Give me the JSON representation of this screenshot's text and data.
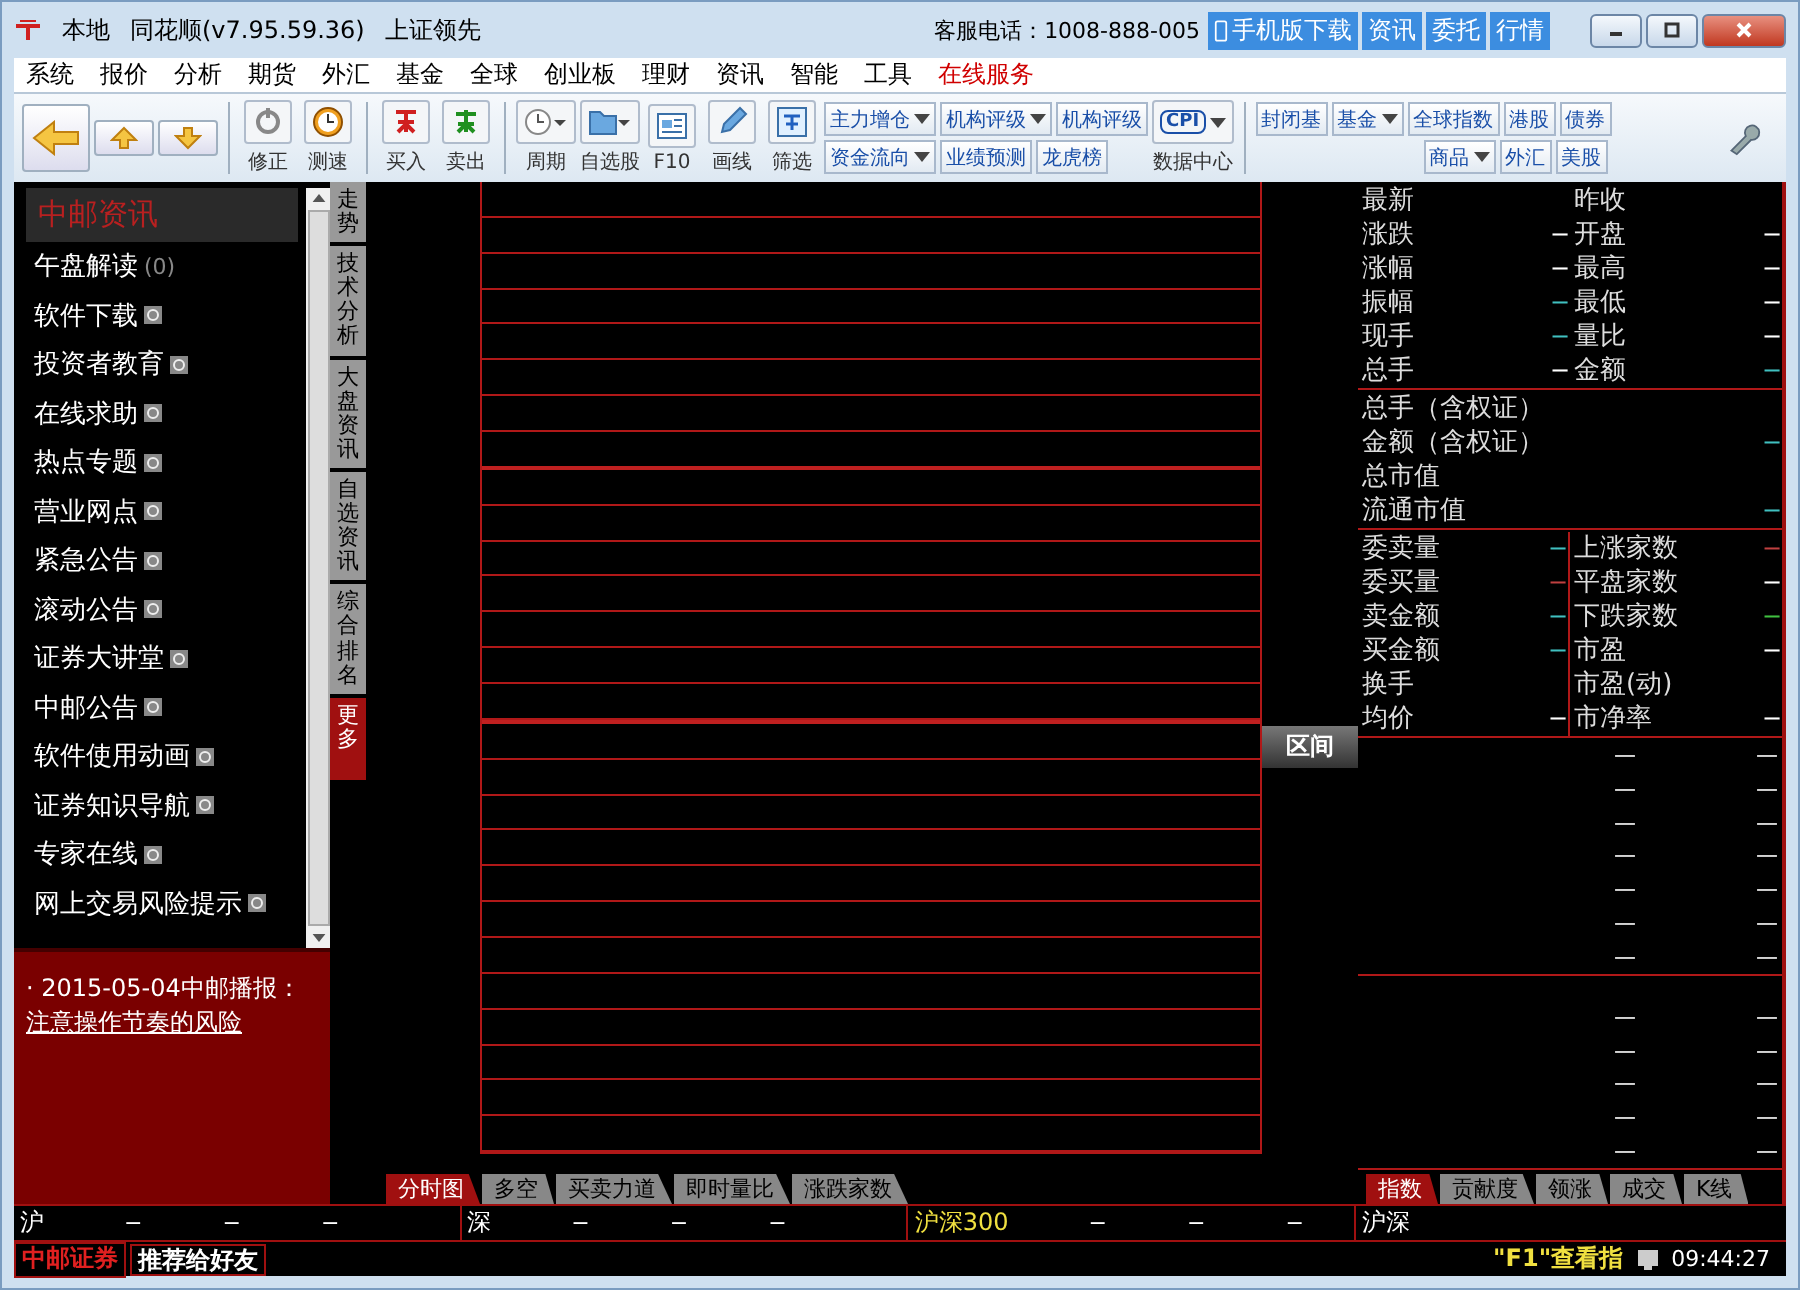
{
  "window": {
    "title_items": [
      "本地",
      "同花顺(v7.95.59.36)",
      "上证领先"
    ],
    "hotline": "客服电话：1008-888-005",
    "top_links": [
      "手机版下载",
      "资讯",
      "委托",
      "行情"
    ]
  },
  "menu": [
    {
      "label": "系统",
      "kind": "normal"
    },
    {
      "label": "报价",
      "kind": "normal"
    },
    {
      "label": "分析",
      "kind": "normal"
    },
    {
      "label": "期货",
      "kind": "normal"
    },
    {
      "label": "外汇",
      "kind": "normal"
    },
    {
      "label": "基金",
      "kind": "normal"
    },
    {
      "label": "全球",
      "kind": "normal"
    },
    {
      "label": "创业板",
      "kind": "normal"
    },
    {
      "label": "理财",
      "kind": "normal"
    },
    {
      "label": "资讯",
      "kind": "normal"
    },
    {
      "label": "智能",
      "kind": "normal"
    },
    {
      "label": "工具",
      "kind": "normal"
    },
    {
      "label": "在线服务",
      "kind": "highlight"
    }
  ],
  "toolbar": {
    "icon_buttons": [
      {
        "label": "修正",
        "kind": "refresh"
      },
      {
        "label": "测速",
        "kind": "clock"
      },
      {
        "label": "买入",
        "kind": "buy"
      },
      {
        "label": "卖出",
        "kind": "sell"
      },
      {
        "label": "周期",
        "kind": "period"
      },
      {
        "label": "自选股",
        "kind": "folder"
      },
      {
        "label": "F10",
        "kind": "f10"
      },
      {
        "label": "画线",
        "kind": "pencil"
      },
      {
        "label": "筛选",
        "kind": "filter"
      }
    ],
    "text_buttons": [
      [
        {
          "label": "主力增仓",
          "dropdown": true
        },
        {
          "label": "机构评级",
          "dropdown": true
        },
        {
          "label": "机构评级",
          "dropdown": false
        }
      ],
      [
        {
          "label": "资金流向",
          "dropdown": true
        },
        {
          "label": "业绩预测",
          "dropdown": false
        },
        {
          "label": "龙虎榜",
          "dropdown": false
        }
      ]
    ],
    "data_center": {
      "icon_text": "CPI",
      "label": "数据中心"
    },
    "market_buttons": [
      [
        {
          "label": "封闭基",
          "dropdown": false
        },
        {
          "label": "基金",
          "dropdown": true
        },
        {
          "label": "全球指数",
          "dropdown": false
        },
        {
          "label": "港股",
          "dropdown": false
        },
        {
          "label": "债券",
          "dropdown": false
        }
      ],
      [
        {
          "label": "商品",
          "dropdown": true
        },
        {
          "label": "外汇",
          "dropdown": false
        },
        {
          "label": "美股",
          "dropdown": false
        }
      ]
    ]
  },
  "sidebar": {
    "header": "中邮资讯",
    "items": [
      {
        "label": "午盘解读",
        "count": "(0)"
      },
      {
        "label": "软件下载"
      },
      {
        "label": "投资者教育"
      },
      {
        "label": "在线求助"
      },
      {
        "label": "热点专题"
      },
      {
        "label": "营业网点"
      },
      {
        "label": "紧急公告"
      },
      {
        "label": "滚动公告"
      },
      {
        "label": "证券大讲堂"
      },
      {
        "label": "中邮公告"
      },
      {
        "label": "软件使用动画"
      },
      {
        "label": "证券知识导航"
      },
      {
        "label": "专家在线"
      },
      {
        "label": "网上交易风险提示"
      }
    ],
    "news": {
      "text": "· 2015-05-04中邮播报：",
      "link": "注意操作节奏的风险"
    }
  },
  "vertical_tabs": [
    {
      "label": "走势",
      "selected": false
    },
    {
      "label": "技术分析",
      "selected": false
    },
    {
      "label": "大盘资讯",
      "selected": false
    },
    {
      "label": "自选资讯",
      "selected": false
    },
    {
      "label": "综合排名",
      "selected": false
    },
    {
      "label": "更多",
      "selected": true
    }
  ],
  "chart": {
    "range_button": "区间"
  },
  "quote": {
    "rows": [
      {
        "left": {
          "label": "最新"
        },
        "right": {
          "label": "昨收"
        }
      },
      {
        "left": {
          "label": "涨跌",
          "value": "−",
          "color": "#ffffff"
        },
        "right": {
          "label": "开盘",
          "value": "−",
          "color": "#ffffff"
        }
      },
      {
        "left": {
          "label": "涨幅",
          "value": "−",
          "color": "#ffffff"
        },
        "right": {
          "label": "最高",
          "value": "−",
          "color": "#ffffff"
        }
      },
      {
        "left": {
          "label": "振幅",
          "value": "−",
          "color": "#40c0c0"
        },
        "right": {
          "label": "最低",
          "value": "−",
          "color": "#ffffff"
        }
      },
      {
        "left": {
          "label": "现手",
          "value": "−",
          "color": "#40c0c0"
        },
        "right": {
          "label": "量比",
          "value": "−",
          "color": "#ffffff"
        }
      },
      {
        "left": {
          "label": "总手",
          "value": "−",
          "color": "#ffffff"
        },
        "right": {
          "label": "金额",
          "value": "−",
          "color": "#40c0c0"
        }
      }
    ],
    "wide_rows": [
      {
        "label": "总手（含权证）"
      },
      {
        "label": "金额（含权证）",
        "value": "−",
        "color": "#40c0c0"
      },
      {
        "label": "总市值"
      },
      {
        "label": "流通市值",
        "value": "−",
        "color": "#40c0c0"
      }
    ],
    "order_rows": [
      {
        "left": {
          "label": "委卖量",
          "value": "−",
          "color": "#40c0c0"
        },
        "right": {
          "label": "上涨家数",
          "value": "−",
          "color": "#c04040"
        }
      },
      {
        "left": {
          "label": "委买量",
          "value": "−",
          "color": "#c04040"
        },
        "right": {
          "label": "平盘家数",
          "value": "−",
          "color": "#ffffff"
        }
      },
      {
        "left": {
          "label": "卖金额",
          "value": "−",
          "color": "#40c0c0"
        },
        "right": {
          "label": "下跌家数",
          "value": "−",
          "color": "#40c040"
        }
      },
      {
        "left": {
          "label": "买金额",
          "value": "−",
          "color": "#40c0c0"
        },
        "right": {
          "label": "市盈",
          "value": "−",
          "color": "#ffffff"
        }
      },
      {
        "left": {
          "label": "换手"
        },
        "right": {
          "label": "市盈(动)"
        }
      },
      {
        "left": {
          "label": "均价",
          "value": "−",
          "color": "#ffffff"
        },
        "right": {
          "label": "市净率",
          "value": "−",
          "color": "#ffffff"
        }
      }
    ],
    "upper_ticks": [
      [
        "—",
        "—"
      ],
      [
        "—",
        "—"
      ],
      [
        "—",
        "—"
      ],
      [
        "—",
        "—"
      ],
      [
        "—",
        "—"
      ],
      [
        "—",
        "—"
      ],
      [
        "—",
        "—"
      ]
    ],
    "lower_ticks": [
      [
        "—",
        "—"
      ],
      [
        "—",
        "—"
      ],
      [
        "—",
        "—"
      ],
      [
        "—",
        "—"
      ],
      [
        "—",
        "—"
      ]
    ]
  },
  "chart_tabs": [
    {
      "label": "分时图",
      "selected": true
    },
    {
      "label": "多空",
      "selected": false
    },
    {
      "label": "买卖力道",
      "selected": false
    },
    {
      "label": "即时量比",
      "selected": false
    },
    {
      "label": "涨跌家数",
      "selected": false
    }
  ],
  "side_tabs": [
    {
      "label": "指数",
      "selected": true
    },
    {
      "label": "贡献度",
      "selected": false
    },
    {
      "label": "领涨",
      "selected": false
    },
    {
      "label": "成交",
      "selected": false
    },
    {
      "label": "K线",
      "selected": false
    }
  ],
  "index_bar": [
    {
      "name": "沪",
      "values": [
        "−",
        "−",
        "−"
      ]
    },
    {
      "name": "深",
      "values": [
        "−",
        "−",
        "−"
      ]
    },
    {
      "name": "沪深300",
      "values": [
        "−",
        "−",
        "−"
      ]
    },
    {
      "name": "沪深"
    }
  ],
  "status_bar": {
    "broker": "中邮证券",
    "recommend": "推荐给好友",
    "hint": "\"F1\"查看指",
    "time": "09:44:27"
  }
}
